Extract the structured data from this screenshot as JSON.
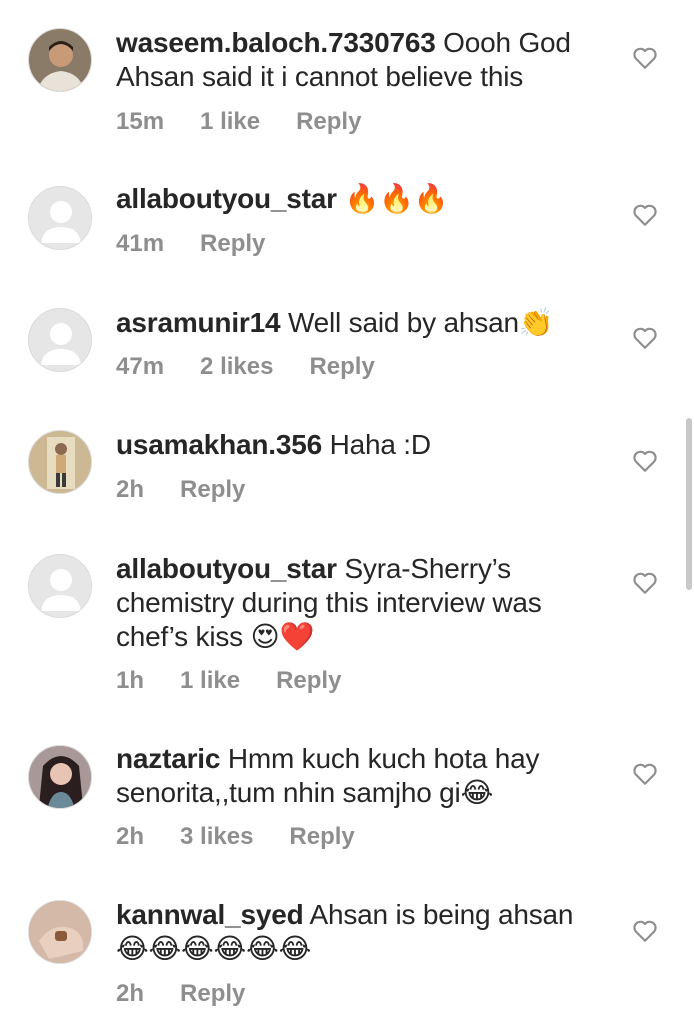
{
  "comments": [
    {
      "username": "waseem.baloch.7330763",
      "text": "Oooh God Ahsan said it i cannot believe this",
      "time": "15m",
      "likes": "1 like",
      "reply": "Reply",
      "avatar": "photo"
    },
    {
      "username": "allaboutyou_star",
      "text": "🔥🔥🔥",
      "time": "41m",
      "likes": "",
      "reply": "Reply",
      "avatar": "default"
    },
    {
      "username": "asramunir14",
      "text": "Well said by ahsan👏",
      "time": "47m",
      "likes": "2 likes",
      "reply": "Reply",
      "avatar": "default"
    },
    {
      "username": "usamakhan.356",
      "text": "Haha :D",
      "time": "2h",
      "likes": "",
      "reply": "Reply",
      "avatar": "photo"
    },
    {
      "username": "allaboutyou_star",
      "text": "Syra-Sherry’s chemistry during this interview was chef’s kiss 😍❤️",
      "time": "1h",
      "likes": "1 like",
      "reply": "Reply",
      "avatar": "default"
    },
    {
      "username": "naztaric",
      "text": "Hmm kuch kuch hota hay senorita,,tum nhin samjho gi😂",
      "time": "2h",
      "likes": "3 likes",
      "reply": "Reply",
      "avatar": "photo"
    },
    {
      "username": "kannwal_syed",
      "text": "Ahsan is being ahsan 😂😂😂😂😂😂",
      "time": "2h",
      "likes": "",
      "reply": "Reply",
      "avatar": "photo"
    }
  ],
  "colors": {
    "text": "#262626",
    "meta": "#8e8e8e",
    "avatar_placeholder": "#e6e6e6"
  },
  "icons": {
    "like": "heart-outline-icon",
    "default_avatar": "default-user-icon"
  }
}
